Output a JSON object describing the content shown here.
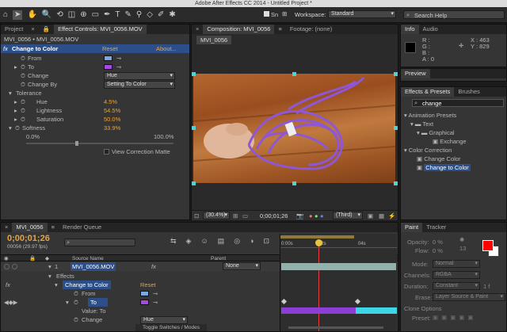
{
  "menubar": {
    "title": "Adobe After Effects CC 2014 - Untitled Project *"
  },
  "toolbar": {
    "snap_label": "Sn",
    "workspace_label": "Workspace:",
    "workspace_value": "Standard",
    "search_placeholder": "Search Help"
  },
  "project": {
    "tab": "Project"
  },
  "effect_controls": {
    "tab": "Effect Controls: MVI_0056.MOV",
    "breadcrumb": "MVI_0056 • MVI_0056.MOV",
    "effect_name": "Change to Color",
    "reset": "Reset",
    "about": "About...",
    "rows": {
      "from": "From",
      "to": "To",
      "change": "Change",
      "change_value": "Hue",
      "change_by": "Change By",
      "change_by_value": "Setting To Color",
      "tolerance": "Tolerance",
      "hue": "Hue",
      "hue_value": "4.5%",
      "lightness": "Lightness",
      "lightness_value": "54.5%",
      "saturation": "Saturation",
      "saturation_value": "50.0%",
      "softness": "Softness",
      "softness_value": "33.9%",
      "slider_min": "0.0%",
      "slider_max": "100.0%",
      "view_correction": "View Correction Matte"
    },
    "from_color": "#7ea7e0",
    "to_color": "#a54cdb"
  },
  "composition": {
    "tab": "Composition: MVI_0056",
    "footage_tab": "Footage: (none)",
    "subtab": "MVI_0056",
    "zoom": "(30.4%)",
    "timecode": "0;00;01;26",
    "resolution": "(Third)"
  },
  "info": {
    "tab": "Info",
    "audio_tab": "Audio",
    "r": "R :",
    "g": "G :",
    "b": "B :",
    "a": "A : 0",
    "x": "X : 463",
    "y": "Y : 829"
  },
  "preview": {
    "tab": "Preview"
  },
  "effects_presets": {
    "tab": "Effects & Presets",
    "brushes_tab": "Brushes",
    "search_value": "change",
    "tree": [
      "Animation Presets",
      "Text",
      "Graphical",
      "Exchange",
      "Color Correction",
      "Change Color",
      "Change to Color"
    ]
  },
  "timeline": {
    "tab": "MVI_0056",
    "render_tab": "Render Queue",
    "timecode": "0;00;01;26",
    "fps": "00056 (29.97 fps)",
    "cols": {
      "source": "Source Name",
      "parent": "Parent"
    },
    "layer_num": "1",
    "layer_name": "MVI_0056.MOV",
    "parent_value": "None",
    "effects": "Effects",
    "effect": "Change to Color",
    "reset": "Reset",
    "from": "From",
    "to": "To",
    "value": "Value: To",
    "change": "Change",
    "change_value": "Hue",
    "toggle": "Toggle Switches / Modes",
    "ruler": [
      "0:00s",
      "02s",
      "04s"
    ]
  },
  "paint": {
    "tab": "Paint",
    "tracker_tab": "Tracker",
    "opacity": "Opacity:",
    "opacity_value": "0 %",
    "flow": "Flow:",
    "flow_value": "0 %",
    "brush_num": "13",
    "mode": "Mode:",
    "mode_value": "Normal",
    "channels": "Channels:",
    "channels_value": "RGBA",
    "duration": "Duration:",
    "duration_value": "Constant",
    "duration_num": "1 f",
    "erase": "Erase:",
    "erase_value": "Layer Source & Paint",
    "clone": "Clone Options",
    "preset": "Preset:",
    "fg_color": "#ff0000",
    "bg_color": "#ffffff"
  }
}
